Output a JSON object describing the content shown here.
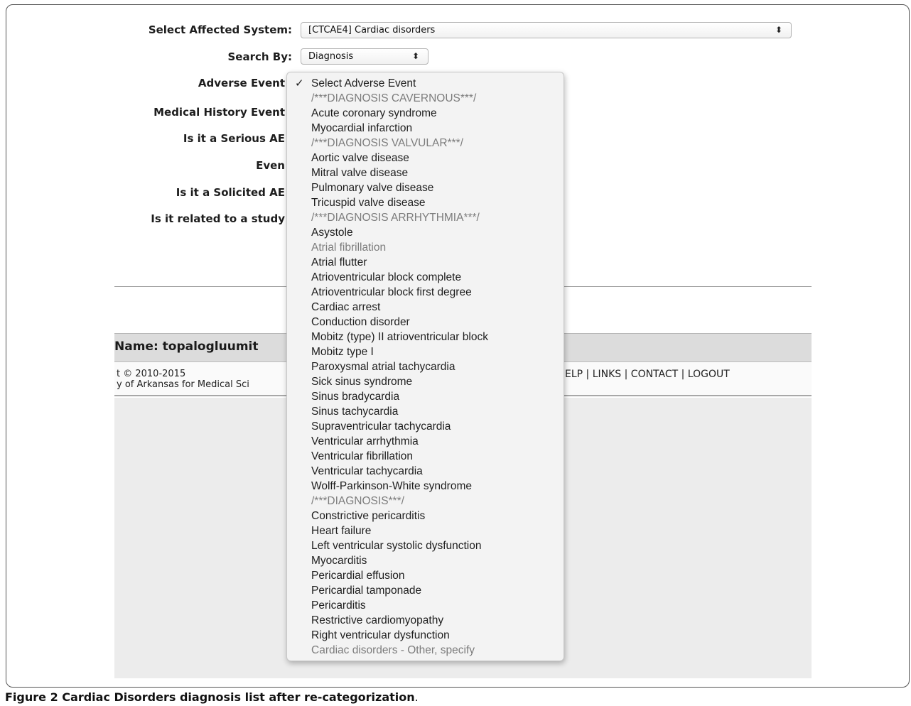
{
  "form": {
    "affected_system_label": "Select Affected System:",
    "affected_system_value": "[CTCAE4] Cardiac disorders",
    "search_by_label": "Search By:",
    "search_by_value": "Diagnosis",
    "adverse_event_label": "Adverse Event",
    "medical_history_label": "Medical History Event",
    "serious_ae_label": "Is it a Serious AE",
    "event_label": "Even",
    "solicited_ae_label": "Is it a Solicited AE",
    "related_study_label": "Is it related to a study",
    "select_arrow_icon": "up-down-arrows-icon"
  },
  "user": {
    "name": "Name: topalogluumit"
  },
  "footer": {
    "copyright_line1": "t © 2010-2015",
    "copyright_line2": "y of Arkansas for Medical Sci",
    "links": "ELP | LINKS | CONTACT | LOGOUT"
  },
  "dropdown": {
    "selected_icon": "checkmark-icon",
    "items": [
      {
        "label": "Select Adverse Event",
        "muted": false,
        "selected": true
      },
      {
        "label": "/***DIAGNOSIS CAVERNOUS***/",
        "muted": true,
        "selected": false
      },
      {
        "label": "Acute coronary syndrome",
        "muted": false,
        "selected": false
      },
      {
        "label": "Myocardial infarction",
        "muted": false,
        "selected": false
      },
      {
        "label": "/***DIAGNOSIS VALVULAR***/",
        "muted": true,
        "selected": false
      },
      {
        "label": "Aortic valve disease",
        "muted": false,
        "selected": false
      },
      {
        "label": "Mitral valve disease",
        "muted": false,
        "selected": false
      },
      {
        "label": "Pulmonary valve disease",
        "muted": false,
        "selected": false
      },
      {
        "label": "Tricuspid valve disease",
        "muted": false,
        "selected": false
      },
      {
        "label": "/***DIAGNOSIS ARRHYTHMIA***/",
        "muted": true,
        "selected": false
      },
      {
        "label": "Asystole",
        "muted": false,
        "selected": false
      },
      {
        "label": "Atrial fibrillation",
        "muted": true,
        "selected": false
      },
      {
        "label": "Atrial flutter",
        "muted": false,
        "selected": false
      },
      {
        "label": "Atrioventricular block complete",
        "muted": false,
        "selected": false
      },
      {
        "label": "Atrioventricular block first degree",
        "muted": false,
        "selected": false
      },
      {
        "label": "Cardiac arrest",
        "muted": false,
        "selected": false
      },
      {
        "label": "Conduction disorder",
        "muted": false,
        "selected": false
      },
      {
        "label": "Mobitz (type) II atrioventricular block",
        "muted": false,
        "selected": false
      },
      {
        "label": "Mobitz type I",
        "muted": false,
        "selected": false
      },
      {
        "label": "Paroxysmal atrial tachycardia",
        "muted": false,
        "selected": false
      },
      {
        "label": "Sick sinus syndrome",
        "muted": false,
        "selected": false
      },
      {
        "label": "Sinus bradycardia",
        "muted": false,
        "selected": false
      },
      {
        "label": "Sinus tachycardia",
        "muted": false,
        "selected": false
      },
      {
        "label": "Supraventricular tachycardia",
        "muted": false,
        "selected": false
      },
      {
        "label": "Ventricular arrhythmia",
        "muted": false,
        "selected": false
      },
      {
        "label": "Ventricular fibrillation",
        "muted": false,
        "selected": false
      },
      {
        "label": "Ventricular tachycardia",
        "muted": false,
        "selected": false
      },
      {
        "label": "Wolff-Parkinson-White syndrome",
        "muted": false,
        "selected": false
      },
      {
        "label": "/***DIAGNOSIS***/",
        "muted": true,
        "selected": false
      },
      {
        "label": "Constrictive pericarditis",
        "muted": false,
        "selected": false
      },
      {
        "label": "Heart failure",
        "muted": false,
        "selected": false
      },
      {
        "label": "Left ventricular systolic dysfunction",
        "muted": false,
        "selected": false
      },
      {
        "label": "Myocarditis",
        "muted": false,
        "selected": false
      },
      {
        "label": "Pericardial effusion",
        "muted": false,
        "selected": false
      },
      {
        "label": "Pericardial tamponade",
        "muted": false,
        "selected": false
      },
      {
        "label": "Pericarditis",
        "muted": false,
        "selected": false
      },
      {
        "label": "Restrictive cardiomyopathy",
        "muted": false,
        "selected": false
      },
      {
        "label": "Right ventricular dysfunction",
        "muted": false,
        "selected": false
      },
      {
        "label": "Cardiac disorders - Other, specify",
        "muted": true,
        "selected": false
      }
    ]
  },
  "caption": {
    "figure_label": "Figure 2",
    "text": " Cardiac Disorders diagnosis list after re-categorization",
    "period": "."
  }
}
